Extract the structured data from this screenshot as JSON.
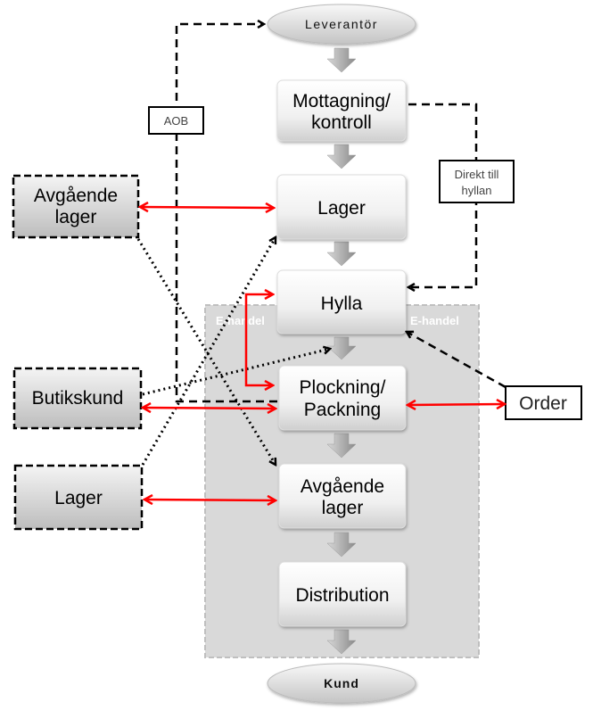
{
  "supplier": "Leverantör",
  "customer": "Kund",
  "zone": {
    "label_left": "E-handel",
    "label_right": "E-handel"
  },
  "process": [
    [
      "Mottagning/",
      "kontroll"
    ],
    [
      "Lager"
    ],
    [
      "Hylla"
    ],
    [
      "Plockning/",
      "Packning"
    ],
    [
      "Avgående",
      "lager"
    ],
    [
      "Distribution"
    ]
  ],
  "external": {
    "outgoing_stock": [
      "Avgående",
      "lager"
    ],
    "store_customer": [
      "Butikskund"
    ],
    "stock": [
      "Lager"
    ],
    "order": "Order"
  },
  "notes": {
    "aob": "AOB",
    "direct_to_shelf": [
      "Direkt till",
      "hyllan"
    ]
  },
  "colors": {
    "flow_red": "#ff0000",
    "zone": "#d9d9d9",
    "box_top": "#ffffff",
    "box_bottom": "#d0d0d0",
    "external_box": "#c8c8c8"
  }
}
